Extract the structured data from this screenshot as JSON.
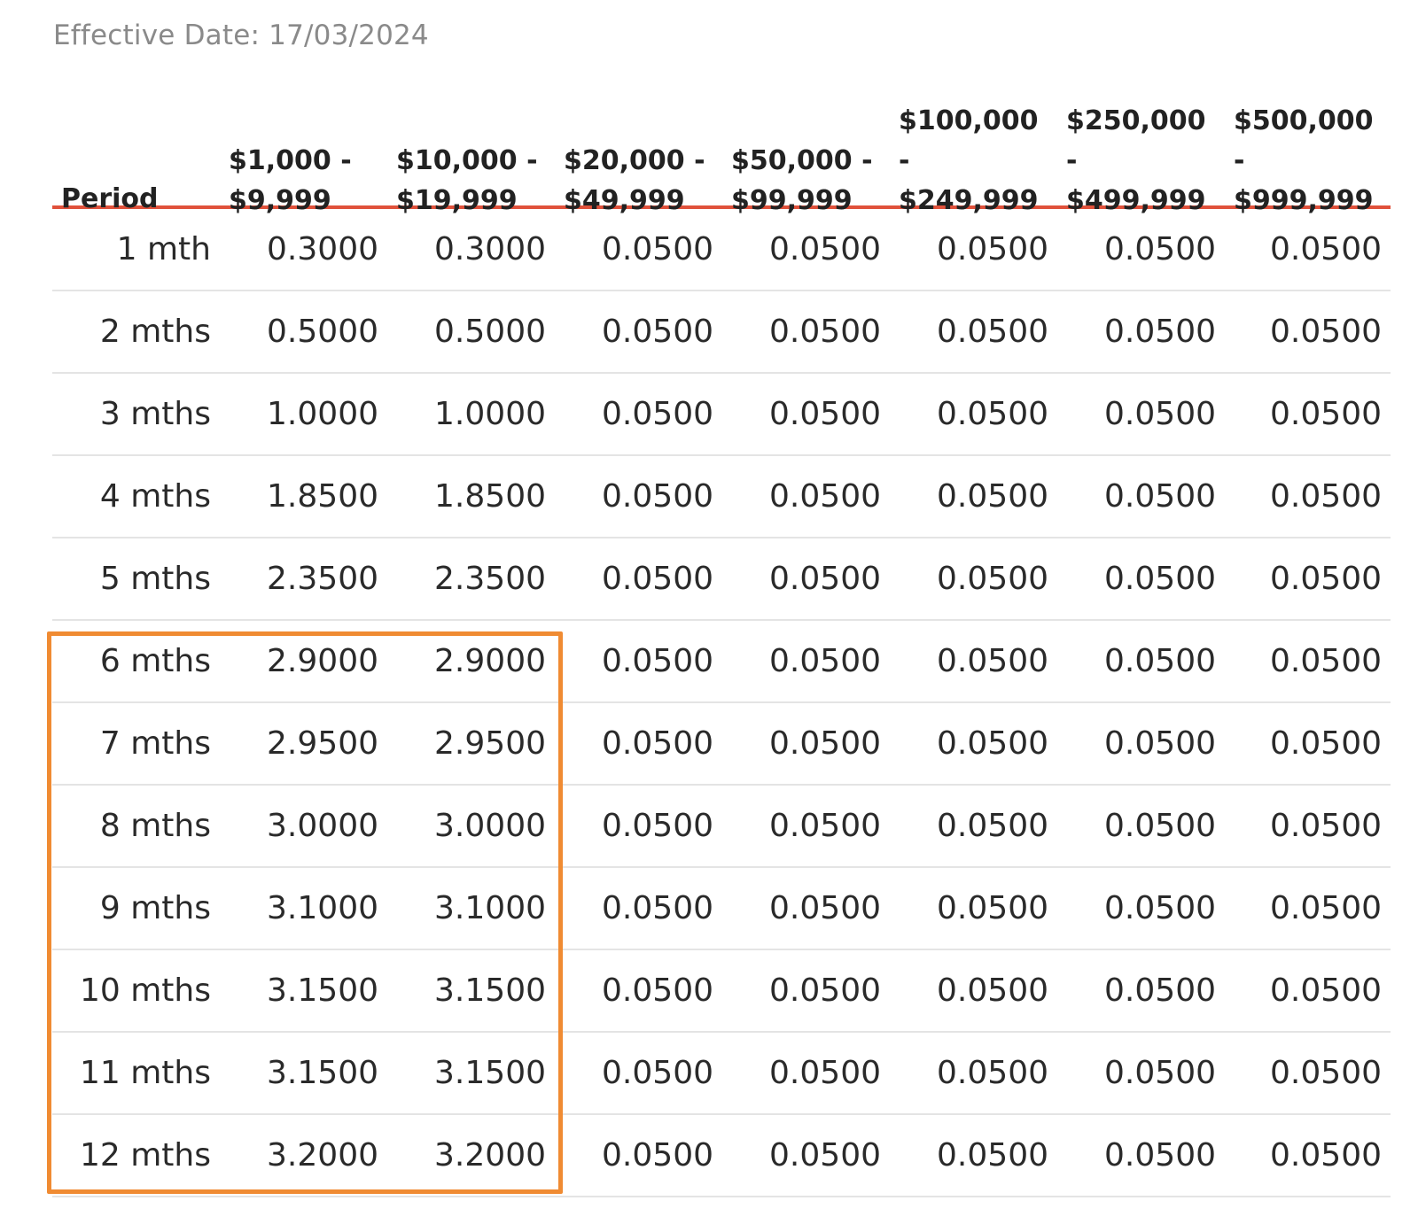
{
  "effective_date": "Effective Date: 17/03/2024",
  "columns": [
    "Period",
    "$1,000 -\n$9,999",
    "$10,000 -\n$19,999",
    "$20,000 -\n$49,999",
    "$50,000 -\n$99,999",
    "$100,000 -\n$249,999",
    "$250,000 -\n$499,999",
    "$500,000 -\n$999,999"
  ],
  "rows": [
    [
      "1 mth",
      "0.3000",
      "0.3000",
      "0.0500",
      "0.0500",
      "0.0500",
      "0.0500",
      "0.0500"
    ],
    [
      "2 mths",
      "0.5000",
      "0.5000",
      "0.0500",
      "0.0500",
      "0.0500",
      "0.0500",
      "0.0500"
    ],
    [
      "3 mths",
      "1.0000",
      "1.0000",
      "0.0500",
      "0.0500",
      "0.0500",
      "0.0500",
      "0.0500"
    ],
    [
      "4 mths",
      "1.8500",
      "1.8500",
      "0.0500",
      "0.0500",
      "0.0500",
      "0.0500",
      "0.0500"
    ],
    [
      "5 mths",
      "2.3500",
      "2.3500",
      "0.0500",
      "0.0500",
      "0.0500",
      "0.0500",
      "0.0500"
    ],
    [
      "6 mths",
      "2.9000",
      "2.9000",
      "0.0500",
      "0.0500",
      "0.0500",
      "0.0500",
      "0.0500"
    ],
    [
      "7 mths",
      "2.9500",
      "2.9500",
      "0.0500",
      "0.0500",
      "0.0500",
      "0.0500",
      "0.0500"
    ],
    [
      "8 mths",
      "3.0000",
      "3.0000",
      "0.0500",
      "0.0500",
      "0.0500",
      "0.0500",
      "0.0500"
    ],
    [
      "9 mths",
      "3.1000",
      "3.1000",
      "0.0500",
      "0.0500",
      "0.0500",
      "0.0500",
      "0.0500"
    ],
    [
      "10 mths",
      "3.1500",
      "3.1500",
      "0.0500",
      "0.0500",
      "0.0500",
      "0.0500",
      "0.0500"
    ],
    [
      "11 mths",
      "3.1500",
      "3.1500",
      "0.0500",
      "0.0500",
      "0.0500",
      "0.0500",
      "0.0500"
    ],
    [
      "12 mths",
      "3.2000",
      "3.2000",
      "0.0500",
      "0.0500",
      "0.0500",
      "0.0500",
      "0.0500"
    ]
  ],
  "colors": {
    "header_rule": "#e0513b",
    "highlight_box": "#f08b32",
    "row_divider": "#e4e4e4"
  }
}
